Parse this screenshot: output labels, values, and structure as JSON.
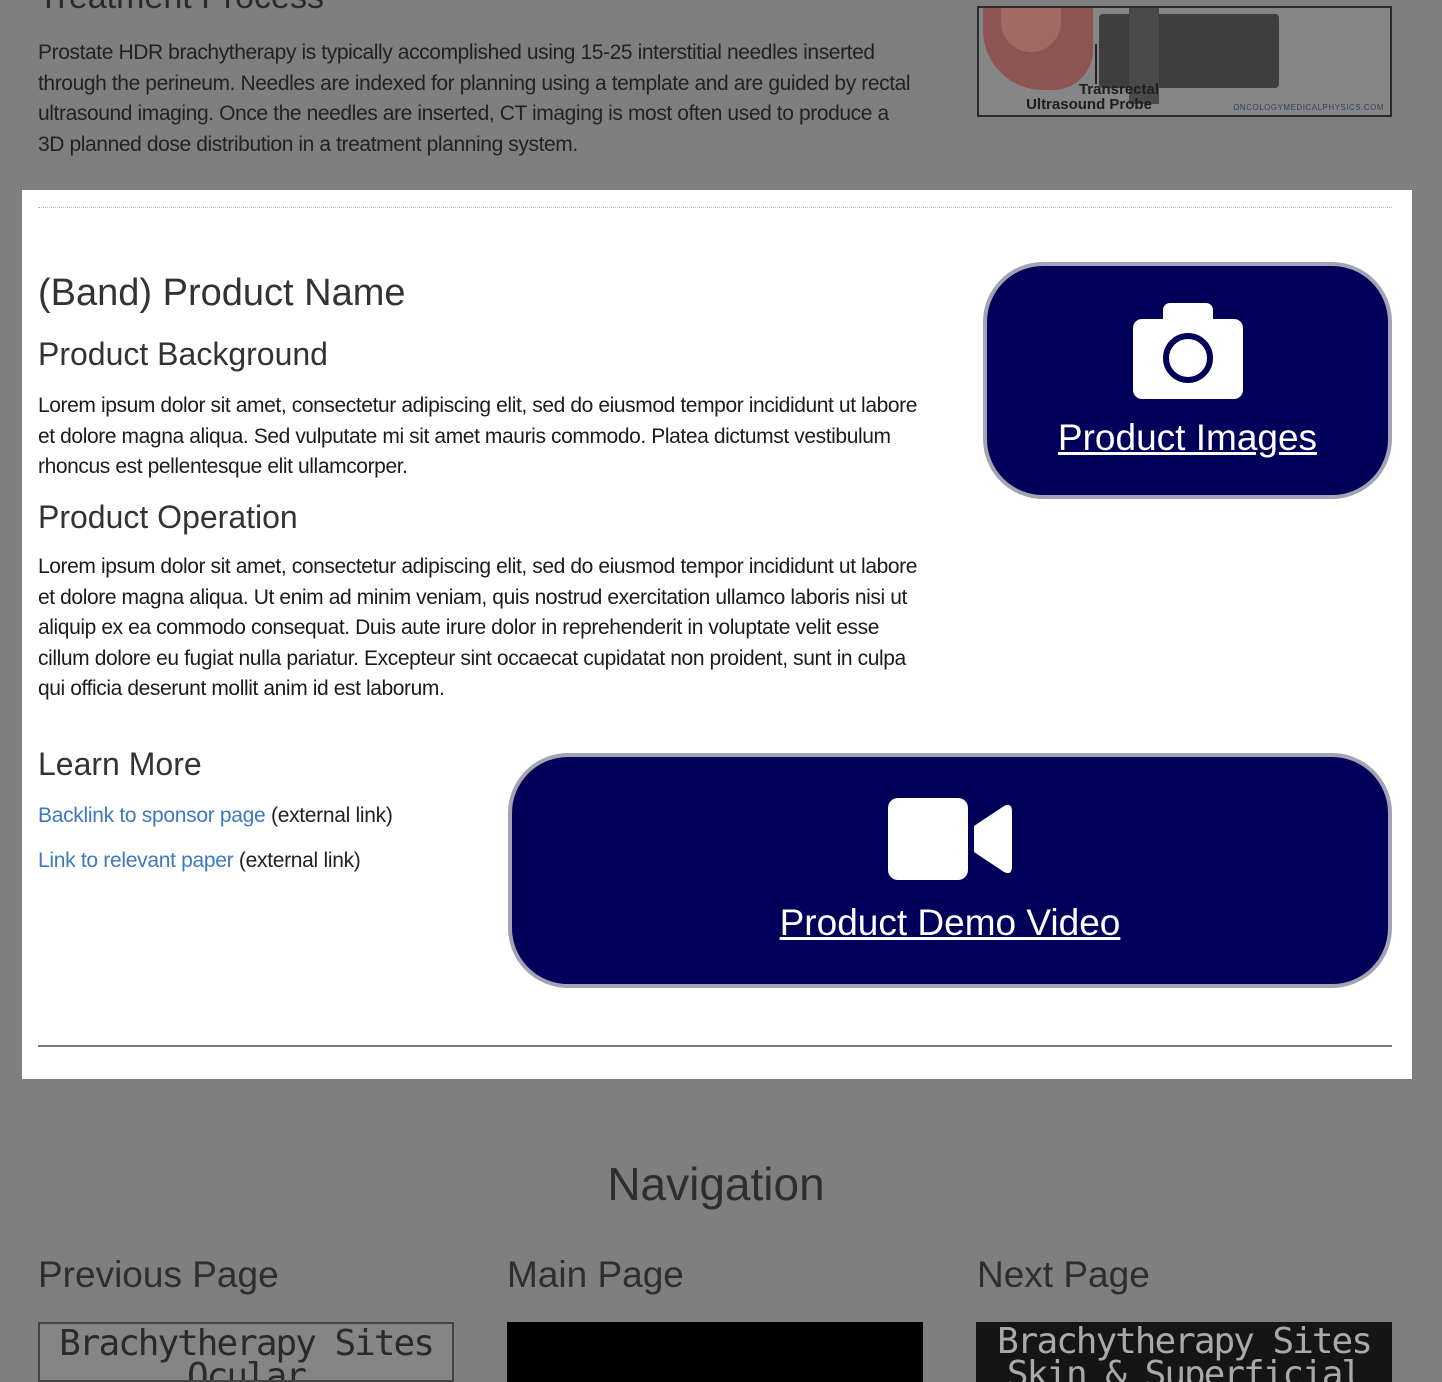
{
  "treatment": {
    "heading": "Treatment Process",
    "text": "Prostate HDR brachytherapy is typically accomplished using 15-25 interstitial needles inserted through the perineum. Needles are indexed for planning using a template and are guided by rectal ultrasound imaging. Once the needles are inserted, CT imaging is most often used to produce a 3D planned dose distribution in a treatment planning system.",
    "image": {
      "label_line1": "Transrectal",
      "label_line2": "Ultrasound Probe",
      "credit": "ONCOLOGYMEDICALPHYSICS.COM"
    }
  },
  "product": {
    "name": "(Band) Product Name",
    "background_heading": "Product Background",
    "background_text": "Lorem ipsum dolor sit amet, consectetur adipiscing elit, sed do eiusmod tempor incididunt ut labore et dolore magna aliqua. Sed vulputate mi sit amet mauris commodo. Platea dictumst vestibulum rhoncus est pellentesque elit ullamcorper.",
    "operation_heading": "Product Operation",
    "operation_text": "Lorem ipsum dolor sit amet, consectetur adipiscing elit, sed do eiusmod tempor incididunt ut labore et dolore magna aliqua. Ut enim ad minim veniam, quis nostrud exercitation ullamco laboris nisi ut aliquip ex ea commodo consequat. Duis aute irure dolor in reprehenderit in voluptate velit esse cillum dolore eu fugiat nulla pariatur. Excepteur sint occaecat cupidatat non proident, sunt in culpa qui officia deserunt mollit anim id est laborum.",
    "learn_more_heading": "Learn More",
    "links": [
      {
        "text": "Backlink to sponsor page",
        "note": "(external link)"
      },
      {
        "text": "Link to relevant paper",
        "note": "(external link)"
      }
    ],
    "images_button": {
      "label": "Product Images",
      "icon": "camera-icon"
    },
    "video_button": {
      "label": "Product Demo Video",
      "icon": "video-camera-icon"
    }
  },
  "navigation": {
    "title": "Navigation",
    "previous": {
      "title": "Previous Page",
      "thumb_line1": "Brachytherapy Sites",
      "thumb_line2": "Ocular"
    },
    "main": {
      "title": "Main Page"
    },
    "next": {
      "title": "Next Page",
      "thumb_line1": "Brachytherapy Sites",
      "thumb_line2": "Skin & Superficial"
    }
  },
  "colors": {
    "overlay": "#7f7f7f",
    "button_bg": "#00005a",
    "link": "#3c7ac0"
  }
}
